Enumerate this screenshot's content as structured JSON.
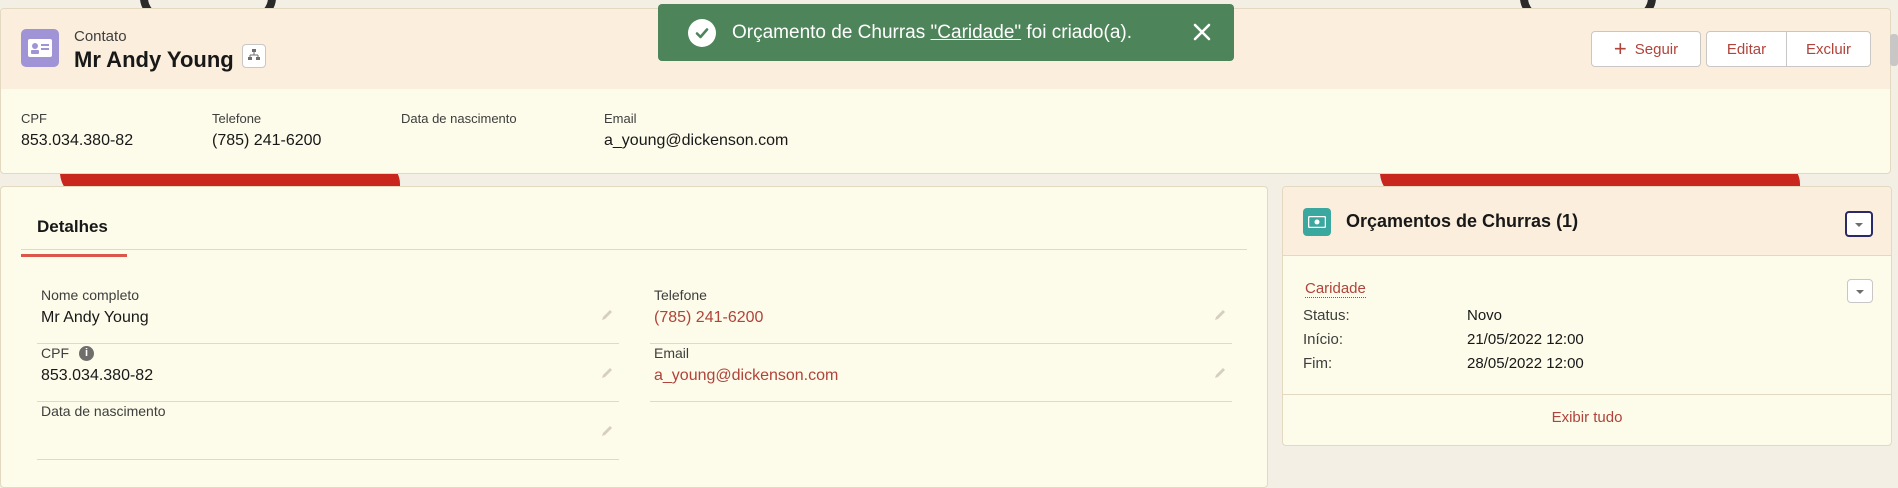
{
  "toast": {
    "prefix": "Orçamento de Churras ",
    "link": "\"Caridade\"",
    "suffix": " foi criado(a).",
    "color": "#4d8459"
  },
  "header": {
    "object_label": "Contato",
    "record_name": "Mr Andy Young",
    "buttons": {
      "follow": "Seguir",
      "edit": "Editar",
      "delete": "Excluir"
    },
    "fields": [
      {
        "label": "CPF",
        "value": "853.034.380-82"
      },
      {
        "label": "Telefone",
        "value": "(785) 241-6200"
      },
      {
        "label": "Data de nascimento",
        "value": ""
      },
      {
        "label": "Email",
        "value": "a_young@dickenson.com"
      }
    ]
  },
  "details": {
    "tab": "Detalhes",
    "fields": {
      "full_name": {
        "label": "Nome completo",
        "value": "Mr Andy Young"
      },
      "phone": {
        "label": "Telefone",
        "value": "(785) 241-6200"
      },
      "cpf": {
        "label": "CPF",
        "value": "853.034.380-82"
      },
      "email": {
        "label": "Email",
        "value": "a_young@dickenson.com"
      },
      "birthdate": {
        "label": "Data de nascimento",
        "value": ""
      }
    }
  },
  "related": {
    "title": "Orçamentos de Churras (1)",
    "record": {
      "name": "Caridade",
      "rows": [
        {
          "key": "Status:",
          "value": "Novo"
        },
        {
          "key": "Início:",
          "value": "21/05/2022 12:00"
        },
        {
          "key": "Fim:",
          "value": "28/05/2022 12:00"
        }
      ]
    },
    "view_all": "Exibir tudo"
  },
  "colors": {
    "accent": "#b0433a",
    "contact_icon": "#a094d6",
    "related_icon": "#3ba8a0"
  }
}
